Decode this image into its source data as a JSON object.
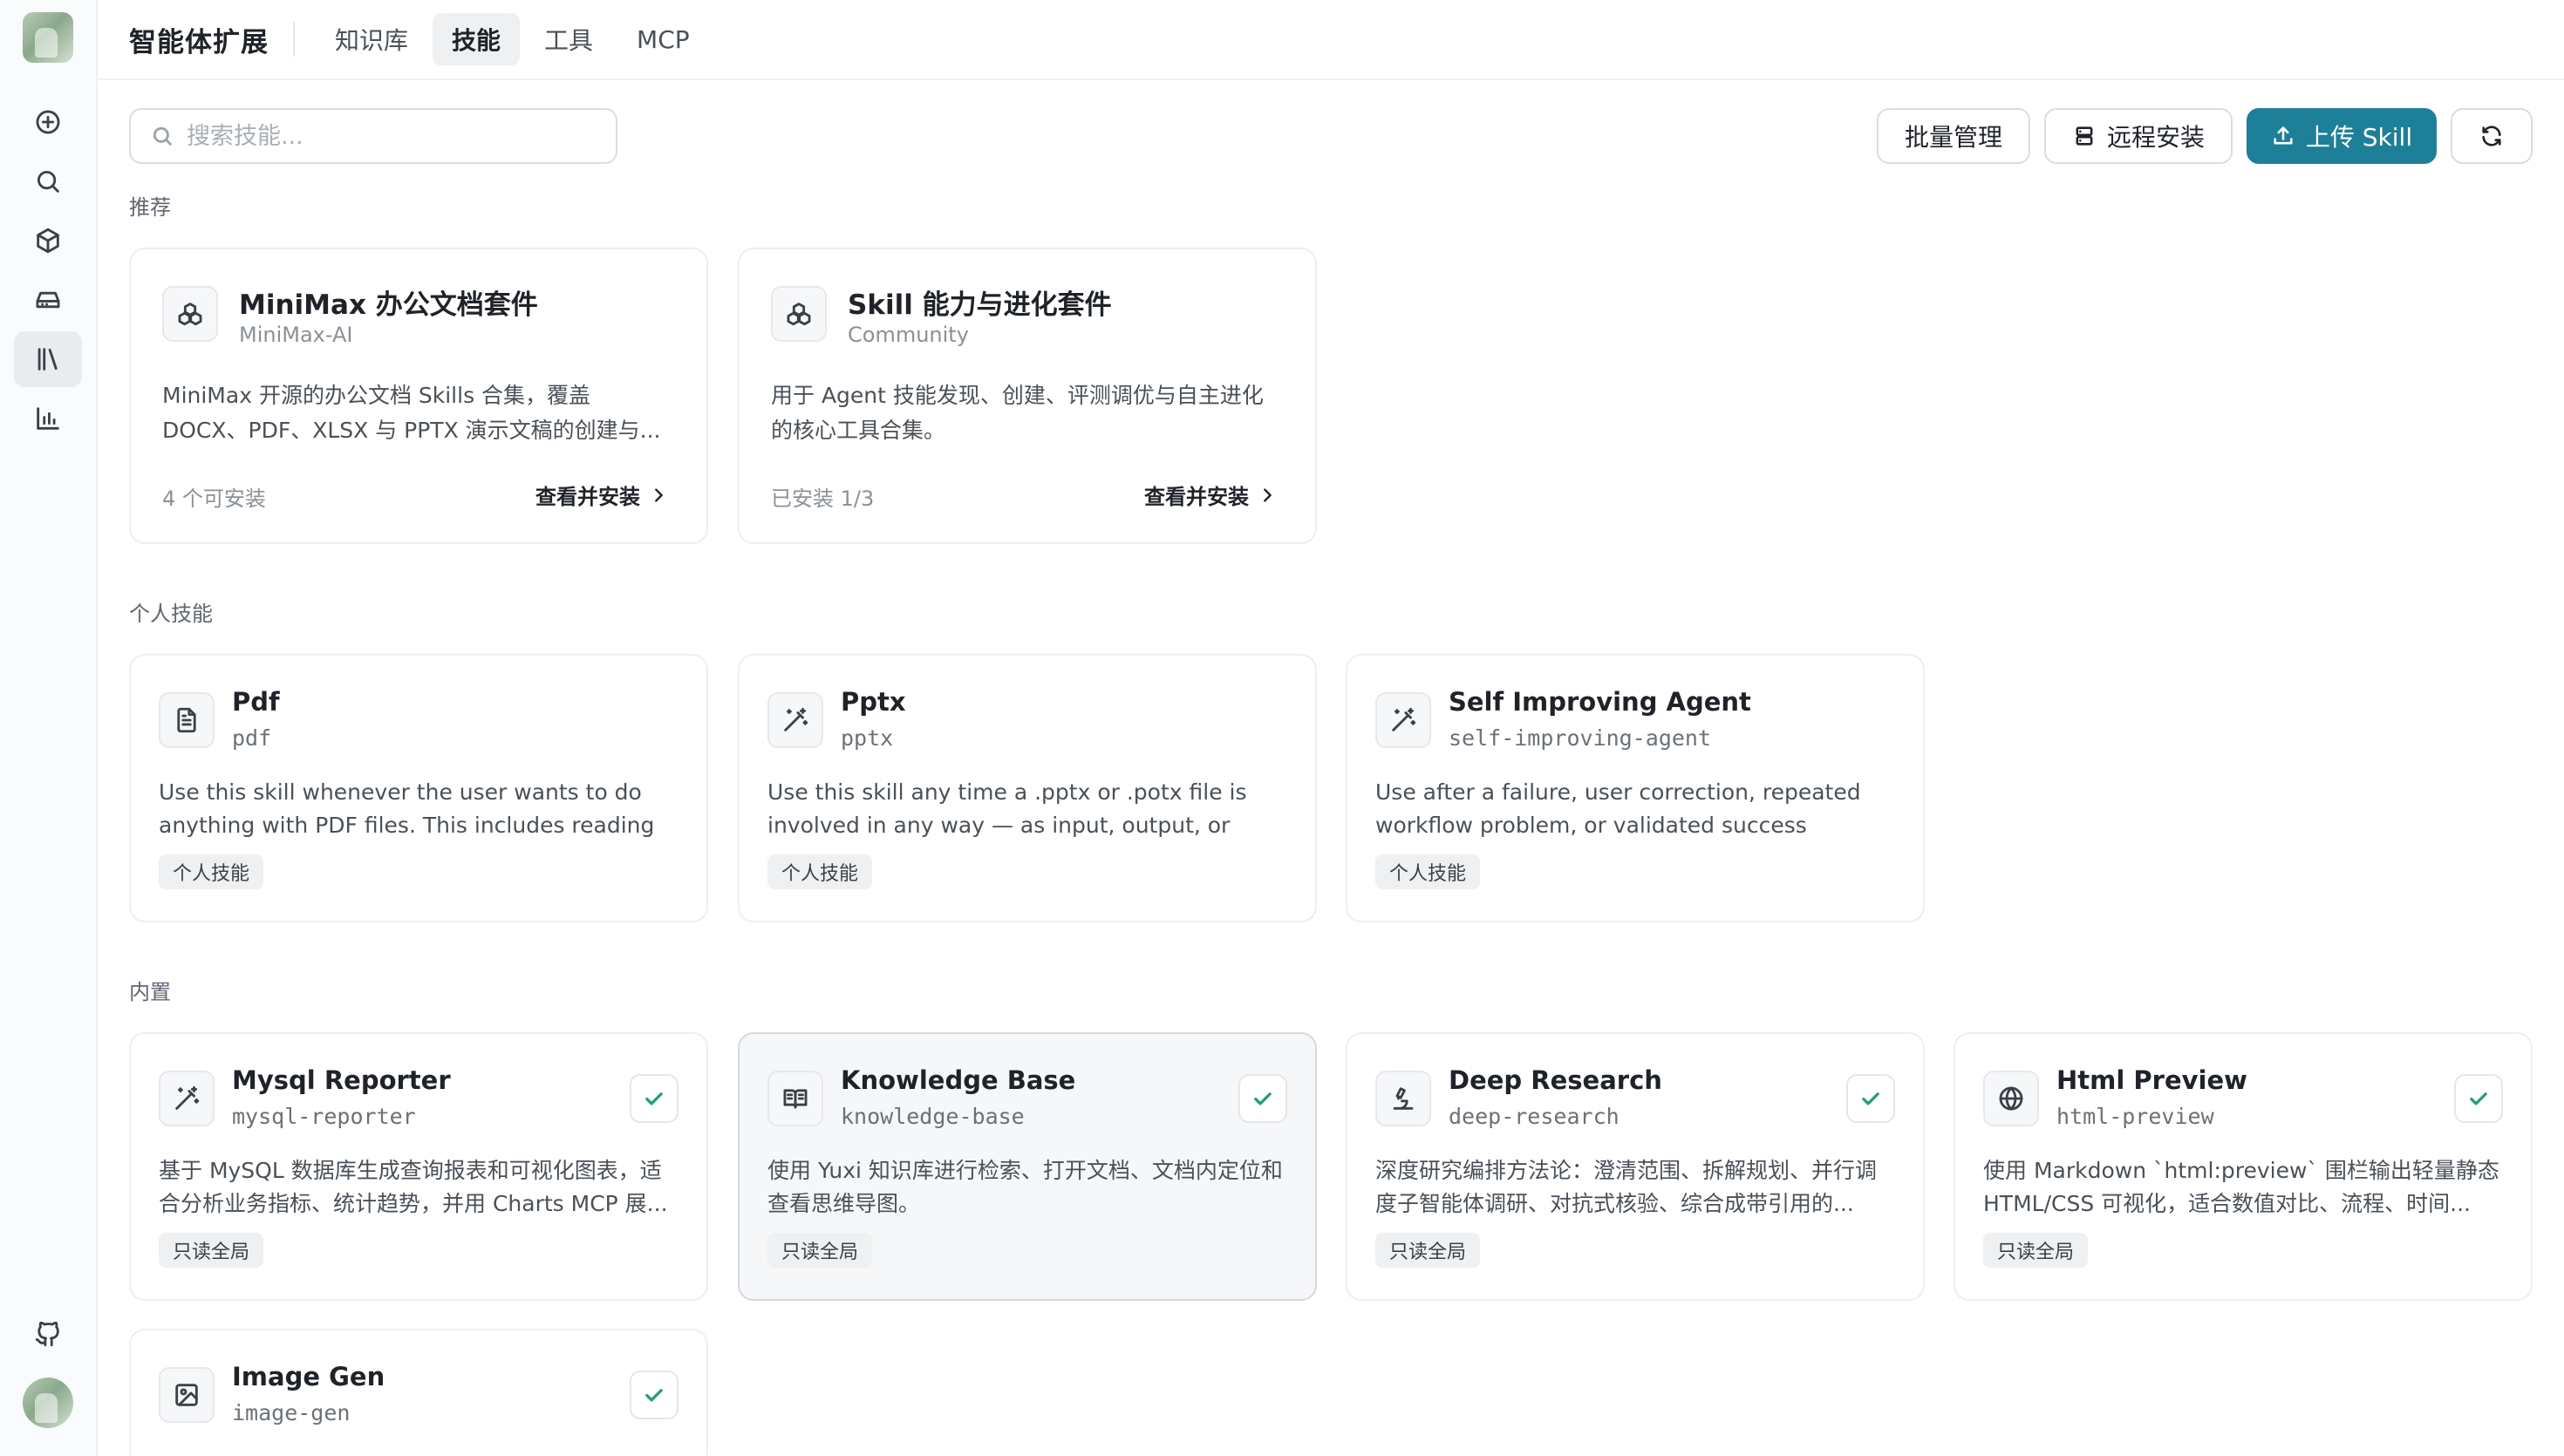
{
  "app_title": "智能体扩展",
  "tabs": [
    {
      "label": "知识库",
      "active": false
    },
    {
      "label": "技能",
      "active": true
    },
    {
      "label": "工具",
      "active": false
    },
    {
      "label": "MCP",
      "active": false
    }
  ],
  "sidebar": {
    "items": [
      {
        "icon": "plus-circle-icon",
        "active": false
      },
      {
        "icon": "search-icon",
        "active": false
      },
      {
        "icon": "cube-icon",
        "active": false
      },
      {
        "icon": "hard-drive-icon",
        "active": false
      },
      {
        "icon": "library-icon",
        "active": true
      },
      {
        "icon": "bar-chart-icon",
        "active": false
      }
    ],
    "bottom": [
      "github-icon",
      "user-avatar"
    ]
  },
  "toolbar": {
    "search_placeholder": "搜索技能...",
    "batch_label": "批量管理",
    "remote_label": "远程安装",
    "upload_label": "上传 Skill",
    "accent_color": "#1e7f98"
  },
  "sections": {
    "recommended": "推荐",
    "personal": "个人技能",
    "builtin": "内置"
  },
  "recommended": [
    {
      "title": "MiniMax 办公文档套件",
      "subtitle": "MiniMax-AI",
      "description": "MiniMax 开源的办公文档 Skills 合集，覆盖 DOCX、PDF、XLSX 与 PPTX 演示文稿的创建与...",
      "status": "4 个可安装",
      "action": "查看并安装"
    },
    {
      "title": "Skill 能力与进化套件",
      "subtitle": "Community",
      "description": "用于 Agent 技能发现、创建、评测调优与自主进化的核心工具合集。",
      "status": "已安装 1/3",
      "action": "查看并安装"
    }
  ],
  "personal": [
    {
      "title": "Pdf",
      "code": "pdf",
      "icon": "file-text-icon",
      "description": "Use this skill whenever the user wants to do anything with PDF files. This includes reading o...",
      "tag": "个人技能"
    },
    {
      "title": "Pptx",
      "code": "pptx",
      "icon": "magic-wand-icon",
      "description": "Use this skill any time a .pptx or .potx file is involved in any way — as input, output, or both....",
      "tag": "个人技能"
    },
    {
      "title": "Self Improving Agent",
      "code": "self-improving-agent",
      "icon": "magic-wand-icon",
      "description": "Use after a failure, user correction, repeated workflow problem, or validated success reveals...",
      "tag": "个人技能"
    }
  ],
  "builtin": [
    {
      "title": "Mysql Reporter",
      "code": "mysql-reporter",
      "icon": "magic-wand-icon",
      "description": "基于 MySQL 数据库生成查询报表和可视化图表，适合分析业务指标、统计趋势，并用 Charts MCP 展...",
      "tag": "只读全局"
    },
    {
      "title": "Knowledge Base",
      "code": "knowledge-base",
      "icon": "book-open-icon",
      "description": "使用 Yuxi 知识库进行检索、打开文档、文档内定位和查看思维导图。",
      "tag": "只读全局"
    },
    {
      "title": "Deep Research",
      "code": "deep-research",
      "icon": "microscope-icon",
      "description": "深度研究编排方法论：澄清范围、拆解规划、并行调度子智能体调研、对抗式核验、综合成带引用的...",
      "tag": "只读全局"
    },
    {
      "title": "Html Preview",
      "code": "html-preview",
      "icon": "globe-icon",
      "description": "使用 Markdown `html:preview` 围栏输出轻量静态 HTML/CSS 可视化，适合数值对比、流程、时间...",
      "tag": "只读全局"
    },
    {
      "title": "Image Gen",
      "code": "image-gen",
      "icon": "image-icon",
      "description": "",
      "tag": ""
    }
  ]
}
